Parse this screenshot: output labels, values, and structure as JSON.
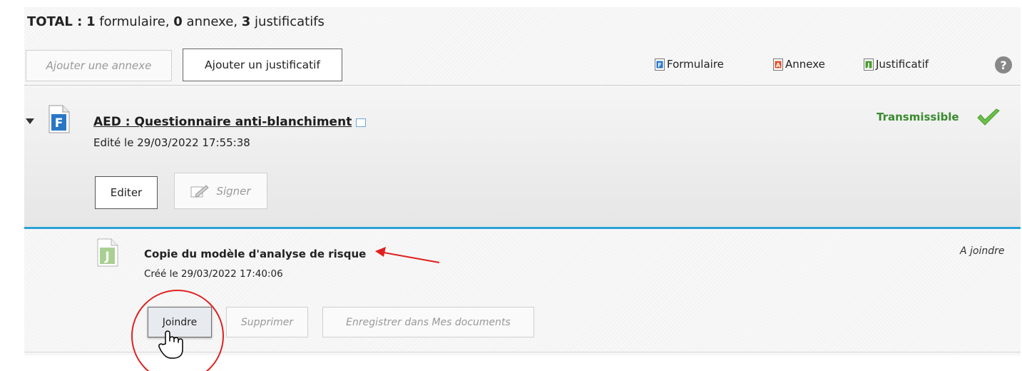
{
  "header": {
    "total_label": "TOTAL :",
    "formulaire_count": "1",
    "formulaire_word": "formulaire,",
    "annexe_count": "0",
    "annexe_word": "annexe,",
    "justificatifs_count": "3",
    "justificatifs_word": "justificatifs"
  },
  "toolbar": {
    "add_annex_label": "Ajouter une annexe",
    "add_justif_label": "Ajouter un justificatif"
  },
  "legend": {
    "formulaire": {
      "label": "Formulaire",
      "letter": "F",
      "color": "#2a76c6"
    },
    "annexe": {
      "label": "Annexe",
      "letter": "A",
      "color": "#e0502a"
    },
    "justificatif": {
      "label": "Justificatif",
      "letter": "J",
      "color": "#4c9e2f"
    },
    "help_icon": "?"
  },
  "form": {
    "icon": "form-document-icon",
    "icon_letter": "F",
    "title": "AED : Questionnaire anti-blanchiment",
    "edited": "Edité le 29/03/2022 17:55:38",
    "status": "Transmissible",
    "status_color": "#3a8a2f",
    "edit_label": "Editer",
    "sign_label": "Signer"
  },
  "justificatif": {
    "icon": "justificatif-document-icon",
    "icon_letter": "J",
    "title": "Copie du modèle d'analyse de risque",
    "created": "Créé le 29/03/2022 17:40:06",
    "status": "A joindre",
    "join_label": "Joindre",
    "delete_label": "Supprimer",
    "save_label": "Enregistrer dans Mes documents"
  },
  "annotations": {
    "arrow_color": "#e02020",
    "circle_color": "#e02020"
  }
}
